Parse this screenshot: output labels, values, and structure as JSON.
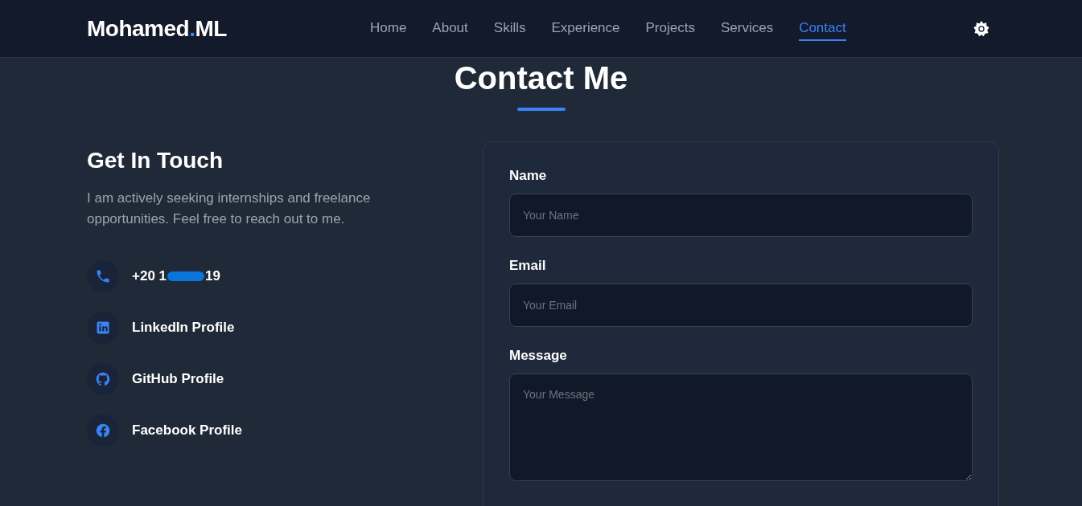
{
  "nav": {
    "logo": {
      "name": "Mohamed",
      "dot": ".",
      "suffix": "ML"
    },
    "links": [
      {
        "label": "Home",
        "selected": false
      },
      {
        "label": "About",
        "selected": false
      },
      {
        "label": "Skills",
        "selected": false
      },
      {
        "label": "Experience",
        "selected": false
      },
      {
        "label": "Projects",
        "selected": false
      },
      {
        "label": "Services",
        "selected": false
      },
      {
        "label": "Contact",
        "selected": true
      }
    ]
  },
  "section_title": "Contact Me",
  "info": {
    "heading": "Get In Touch",
    "text": "I am actively seeking internships and freelance opportunities. Feel free to reach out to me.",
    "items": [
      {
        "kind": "phone",
        "label": "+20 1",
        "label_end": "19",
        "redacted": true
      },
      {
        "kind": "linkedin",
        "label": "LinkedIn Profile"
      },
      {
        "kind": "github",
        "label": "GitHub Profile"
      },
      {
        "kind": "facebook",
        "label": "Facebook Profile"
      }
    ]
  },
  "form": {
    "fields": [
      {
        "kind": "input",
        "label": "Name",
        "placeholder": "Your Name"
      },
      {
        "kind": "input",
        "label": "Email",
        "placeholder": "Your Email"
      },
      {
        "kind": "textarea",
        "label": "Message",
        "placeholder": "Your Message"
      }
    ]
  }
}
